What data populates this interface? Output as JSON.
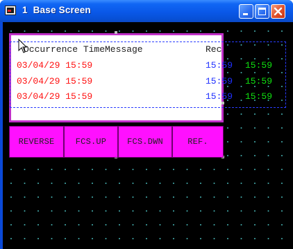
{
  "window": {
    "title": "1  Base Screen",
    "buttons": {
      "minimize": "minimize",
      "maximize": "maximize",
      "close": "close"
    }
  },
  "alarm_list": {
    "header": {
      "col1": "Occurrence Time",
      "col2": "Message",
      "col3": "Rec"
    },
    "rows": [
      {
        "time": "03/04/29 15:59",
        "rec_blue": "15:59",
        "rec_green": "15:59"
      },
      {
        "time": "03/04/29 15:59",
        "rec_blue": "15:59",
        "rec_green": "15:59"
      },
      {
        "time": "03/04/29 15:59",
        "rec_blue": "15:59",
        "rec_green": "15:59"
      }
    ]
  },
  "function_keys": [
    {
      "label": "REVERSE"
    },
    {
      "label": "FCS.UP"
    },
    {
      "label": "FCS.DWN"
    },
    {
      "label": "REF."
    }
  ],
  "colors": {
    "title_bar": "#0a58e8",
    "alarm_border": "#c030c8",
    "fkey_bg": "#ff10ff",
    "time_text": "#ff1010",
    "rec_blue": "#2030ff",
    "rec_green": "#10e010",
    "canvas_bg": "#000000"
  },
  "icons": {
    "app": "screen-icon",
    "pointer": "mouse-pointer-icon"
  }
}
